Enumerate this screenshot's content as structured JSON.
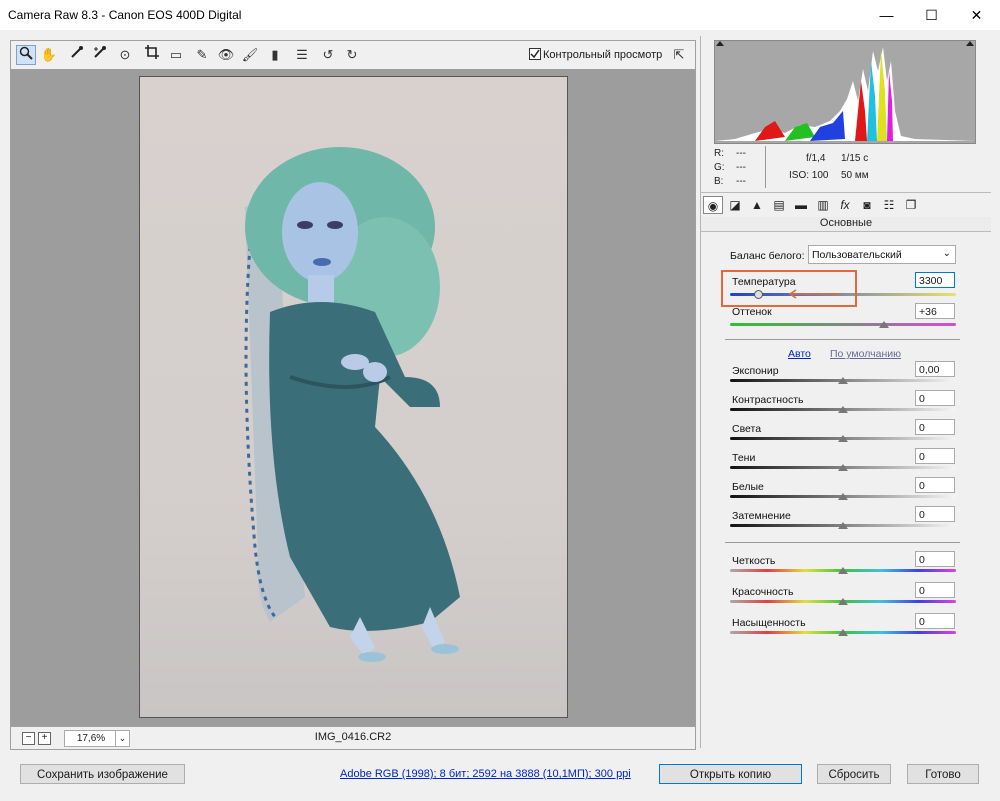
{
  "window": {
    "title": "Camera Raw 8.3  -  Canon EOS 400D Digital",
    "minimize_glyph": "—",
    "maximize_glyph": "☐",
    "close_glyph": "✕"
  },
  "toolbar": {
    "preview_label": "Контрольный просмотр",
    "preview_checked": true,
    "tools": [
      "zoom-icon",
      "hand-icon",
      "white-balance-icon",
      "color-sampler-icon",
      "target-adjust-icon",
      "crop-icon",
      "straighten-icon",
      "spot-removal-icon",
      "red-eye-icon",
      "adjustment-brush-icon",
      "graduated-filter-icon",
      "list-icon",
      "rotate-left-icon",
      "rotate-right-icon"
    ]
  },
  "status": {
    "zoom_minus": "−",
    "zoom_plus": "+",
    "zoom_value": "17,6%",
    "zoom_dropdown": "⌄",
    "filename": "IMG_0416.CR2"
  },
  "info": {
    "r_label": "R:",
    "r_value": "---",
    "g_label": "G:",
    "g_value": "---",
    "b_label": "B:",
    "b_value": "---",
    "aperture": "f/1,4",
    "shutter": "1/15 с",
    "iso": "ISO: 100",
    "focal": "50 мм"
  },
  "panel": {
    "section_title": "Основные",
    "white_balance_label": "Баланс белого:",
    "white_balance_value": "Пользовательский",
    "temperature_label": "Температура",
    "temperature_value": "3300",
    "temperature_pos": 0.13,
    "tint_label": "Оттенок",
    "tint_value": "+36",
    "tint_pos": 0.68,
    "auto_label": "Авто",
    "default_label": "По умолчанию",
    "tone": [
      {
        "label": "Экспонир",
        "value": "0,00",
        "pos": 0.5
      },
      {
        "label": "Контрастность",
        "value": "0",
        "pos": 0.5
      },
      {
        "label": "Света",
        "value": "0",
        "pos": 0.5
      },
      {
        "label": "Тени",
        "value": "0",
        "pos": 0.5
      },
      {
        "label": "Белые",
        "value": "0",
        "pos": 0.5
      },
      {
        "label": "Затемнение",
        "value": "0",
        "pos": 0.5
      }
    ],
    "presence": [
      {
        "label": "Четкость",
        "value": "0",
        "pos": 0.5
      },
      {
        "label": "Красочность",
        "value": "0",
        "pos": 0.5
      },
      {
        "label": "Насыщенность",
        "value": "0",
        "pos": 0.5
      }
    ]
  },
  "footer": {
    "save_label": "Сохранить изображение",
    "workflow_link": "Adobe RGB (1998); 8 бит; 2592 на 3888 (10,1МП); 300 ppi",
    "open_copy_label": "Открыть копию",
    "reset_label": "Сбросить",
    "done_label": "Готово"
  },
  "colors": {
    "highlight_box": "#e06a3d",
    "link": "#0026c4",
    "arrow": "#e06a3d"
  }
}
